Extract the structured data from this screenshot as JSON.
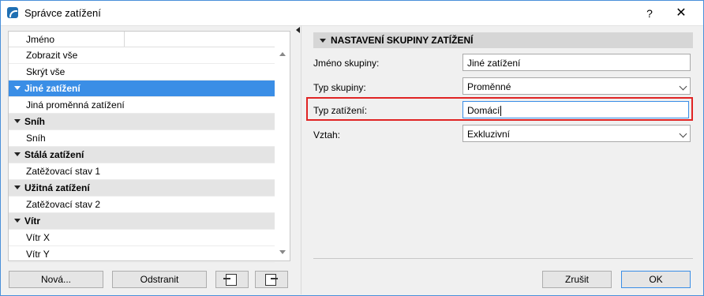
{
  "window": {
    "title": "Správce zatížení",
    "help": "?",
    "close": "✕"
  },
  "list": {
    "header": "Jméno",
    "rows": [
      {
        "label": "Zobrazit vše",
        "kind": "item"
      },
      {
        "label": "Skrýt vše",
        "kind": "item"
      },
      {
        "label": "Jiné zatížení",
        "kind": "group-selected"
      },
      {
        "label": "Jiná proměnná zatížení",
        "kind": "item"
      },
      {
        "label": "Sníh",
        "kind": "group"
      },
      {
        "label": "Sníh",
        "kind": "item"
      },
      {
        "label": "Stálá zatížení",
        "kind": "group"
      },
      {
        "label": "Zatěžovací stav 1",
        "kind": "item"
      },
      {
        "label": "Užitná zatížení",
        "kind": "group"
      },
      {
        "label": "Zatěžovací stav 2",
        "kind": "item"
      },
      {
        "label": "Vítr",
        "kind": "group"
      },
      {
        "label": "Vítr X",
        "kind": "item"
      },
      {
        "label": "Vítr Y",
        "kind": "item"
      }
    ]
  },
  "buttons": {
    "new": "Nová...",
    "delete": "Odstranit",
    "import_icon": "import-icon",
    "export_icon": "export-icon",
    "cancel": "Zrušit",
    "ok": "OK"
  },
  "panel": {
    "section_title": "NASTAVENÍ SKUPINY ZATÍŽENÍ",
    "group_name_label": "Jméno skupiny:",
    "group_name_value": "Jiné zatížení",
    "group_type_label": "Typ skupiny:",
    "group_type_value": "Proměnné",
    "load_type_label": "Typ zatížení:",
    "load_type_value": "Domácí",
    "relation_label": "Vztah:",
    "relation_value": "Exkluzivní"
  },
  "colors": {
    "selection": "#3a8ee6",
    "highlight": "#e02424",
    "group_row": "#e4e4e4"
  }
}
